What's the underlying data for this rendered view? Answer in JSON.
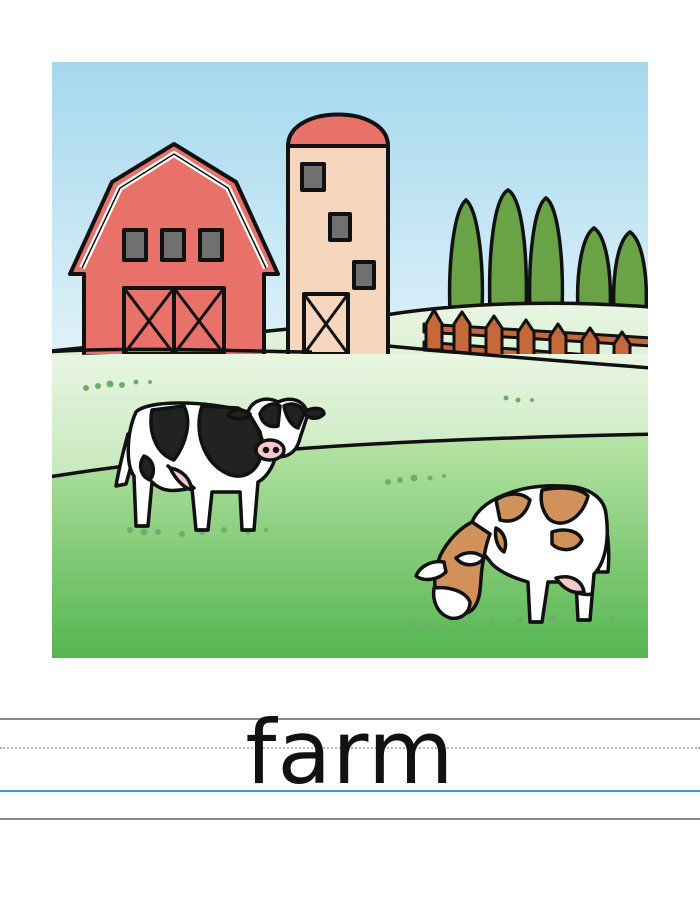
{
  "card": {
    "word": "farm"
  },
  "colors": {
    "sky_top": "#a4d8ee",
    "sky_bottom": "#ffffff",
    "grass_light": "#e9f6e2",
    "grass": "#7cc870",
    "grass_dark": "#4fb24a",
    "barn_red": "#e8716a",
    "silo_body": "#f6d6bd",
    "tree_green": "#6aa246",
    "fence_brown": "#c6683a",
    "window_gray": "#707070",
    "cow_brown": "#d0915a",
    "outline": "#111111",
    "baseline_blue": "#3b9ad9"
  },
  "icons": {
    "barn": "barn-icon",
    "silo": "silo-icon",
    "trees": "tree-icon",
    "fence": "fence-icon",
    "cow_standing": "cow-icon",
    "cow_grazing": "cow-icon"
  }
}
